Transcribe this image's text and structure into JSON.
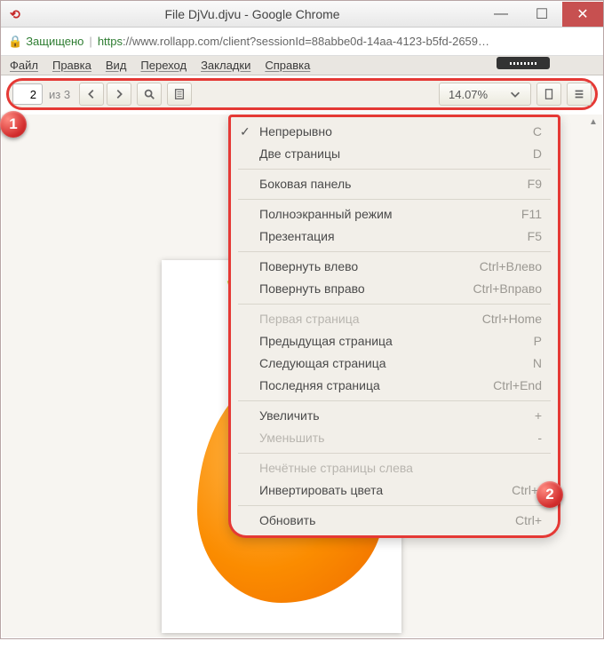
{
  "browser": {
    "title": "File DjVu.djvu - Google Chrome",
    "secure_label": "Защищено",
    "url_prefix": "https",
    "url_rest": "://www.rollapp.com/client?sessionId=88abbe0d-14aa-4123-b5fd-2659…"
  },
  "menubar": {
    "file": "Файл",
    "edit": "Правка",
    "view": "Вид",
    "go": "Переход",
    "bookmarks": "Закладки",
    "help": "Справка"
  },
  "toolbar": {
    "page_value": "2",
    "page_of": "из 3",
    "zoom_value": "14.07%"
  },
  "context_menu": {
    "continuous": {
      "label": "Непрерывно",
      "shortcut": "C",
      "checked": true
    },
    "dual": {
      "label": "Две страницы",
      "shortcut": "D"
    },
    "sidebar": {
      "label": "Боковая панель",
      "shortcut": "F9"
    },
    "fullscreen": {
      "label": "Полноэкранный режим",
      "shortcut": "F11"
    },
    "presentation": {
      "label": "Презентация",
      "shortcut": "F5"
    },
    "rotate_left": {
      "label": "Повернуть влево",
      "shortcut": "Ctrl+Влево"
    },
    "rotate_right": {
      "label": "Повернуть вправо",
      "shortcut": "Ctrl+Вправо"
    },
    "first_page": {
      "label": "Первая страница",
      "shortcut": "Ctrl+Home"
    },
    "prev_page": {
      "label": "Предыдущая страница",
      "shortcut": "P"
    },
    "next_page": {
      "label": "Следующая страница",
      "shortcut": "N"
    },
    "last_page": {
      "label": "Последняя страница",
      "shortcut": "Ctrl+End"
    },
    "zoom_in": {
      "label": "Увеличить",
      "shortcut": "+"
    },
    "zoom_out": {
      "label": "Уменьшить",
      "shortcut": "-"
    },
    "odd_left": {
      "label": "Нечётные страницы слева",
      "shortcut": ""
    },
    "invert": {
      "label": "Инвертировать цвета",
      "shortcut": "Ctrl+I"
    },
    "reload": {
      "label": "Обновить",
      "shortcut": "Ctrl+"
    }
  },
  "badges": {
    "one": "1",
    "two": "2"
  }
}
